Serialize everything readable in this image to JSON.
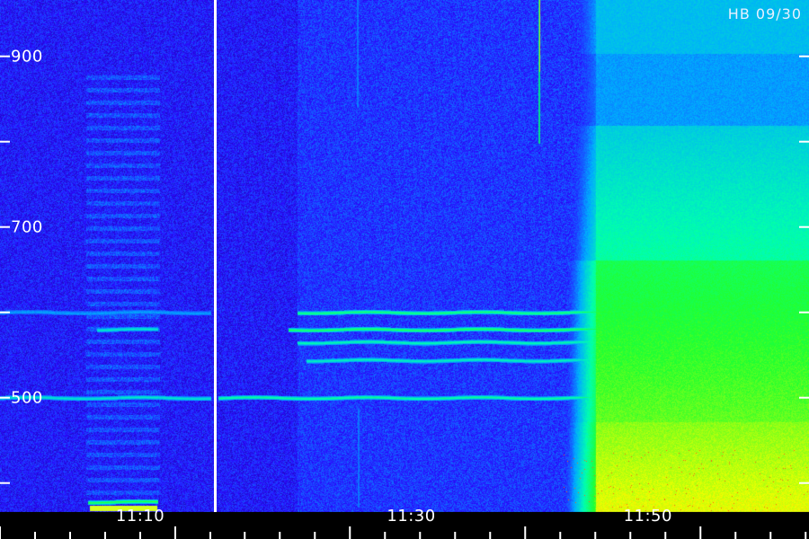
{
  "chart_data": {
    "type": "heatmap",
    "title": "",
    "corner_label": "HB 09/30",
    "xlabel": "",
    "ylabel": "",
    "colors": [
      "#06002a",
      "#2a0cff",
      "#00aaff",
      "#00ffb0",
      "#20ff30",
      "#f0ff00",
      "#ff2020"
    ],
    "y_axis": {
      "range": [
        366,
        966
      ],
      "ticks": [
        {
          "value": 900,
          "label": "900"
        },
        {
          "value": 800,
          "label": ""
        },
        {
          "value": 700,
          "label": "700"
        },
        {
          "value": 600,
          "label": ""
        },
        {
          "value": 500,
          "label": "500"
        },
        {
          "value": 400,
          "label": ""
        }
      ]
    },
    "panels": [
      {
        "name": "panel-1",
        "start_minute": 0,
        "end_minute": 12,
        "time_labels": [
          {
            "minute": 8,
            "label": "11:10"
          }
        ],
        "bands": [
          {
            "value": 500,
            "start_minute": 0,
            "end_minute": 12,
            "intensity": 0.45
          },
          {
            "value": 580,
            "start_minute": 5.5,
            "end_minute": 9,
            "intensity": 0.45
          },
          {
            "value": 600,
            "start_minute": 0,
            "end_minute": 12,
            "intensity": 0.2
          },
          {
            "value": 378,
            "start_minute": 5,
            "end_minute": 9,
            "intensity": 0.8
          }
        ]
      },
      {
        "name": "panel-2",
        "start_minute": 12.5,
        "end_minute": 46,
        "time_labels": [
          {
            "minute": 23.5,
            "label": "11:30"
          },
          {
            "minute": 37,
            "label": "11:50"
          }
        ],
        "bands": [
          {
            "value": 600,
            "start_minute": 17,
            "end_minute": 46,
            "intensity": 0.7
          },
          {
            "value": 580,
            "start_minute": 16.5,
            "end_minute": 46,
            "intensity": 0.75
          },
          {
            "value": 565,
            "start_minute": 17,
            "end_minute": 34,
            "intensity": 0.55
          },
          {
            "value": 544,
            "start_minute": 17.5,
            "end_minute": 34,
            "intensity": 0.5
          },
          {
            "value": 500,
            "start_minute": 12.5,
            "end_minute": 34,
            "intensity": 0.6
          }
        ]
      }
    ],
    "burst": {
      "start_minute": 34,
      "end_minute": 46,
      "peak_value_range": [
        366,
        650
      ],
      "intensity": 0.85
    }
  }
}
